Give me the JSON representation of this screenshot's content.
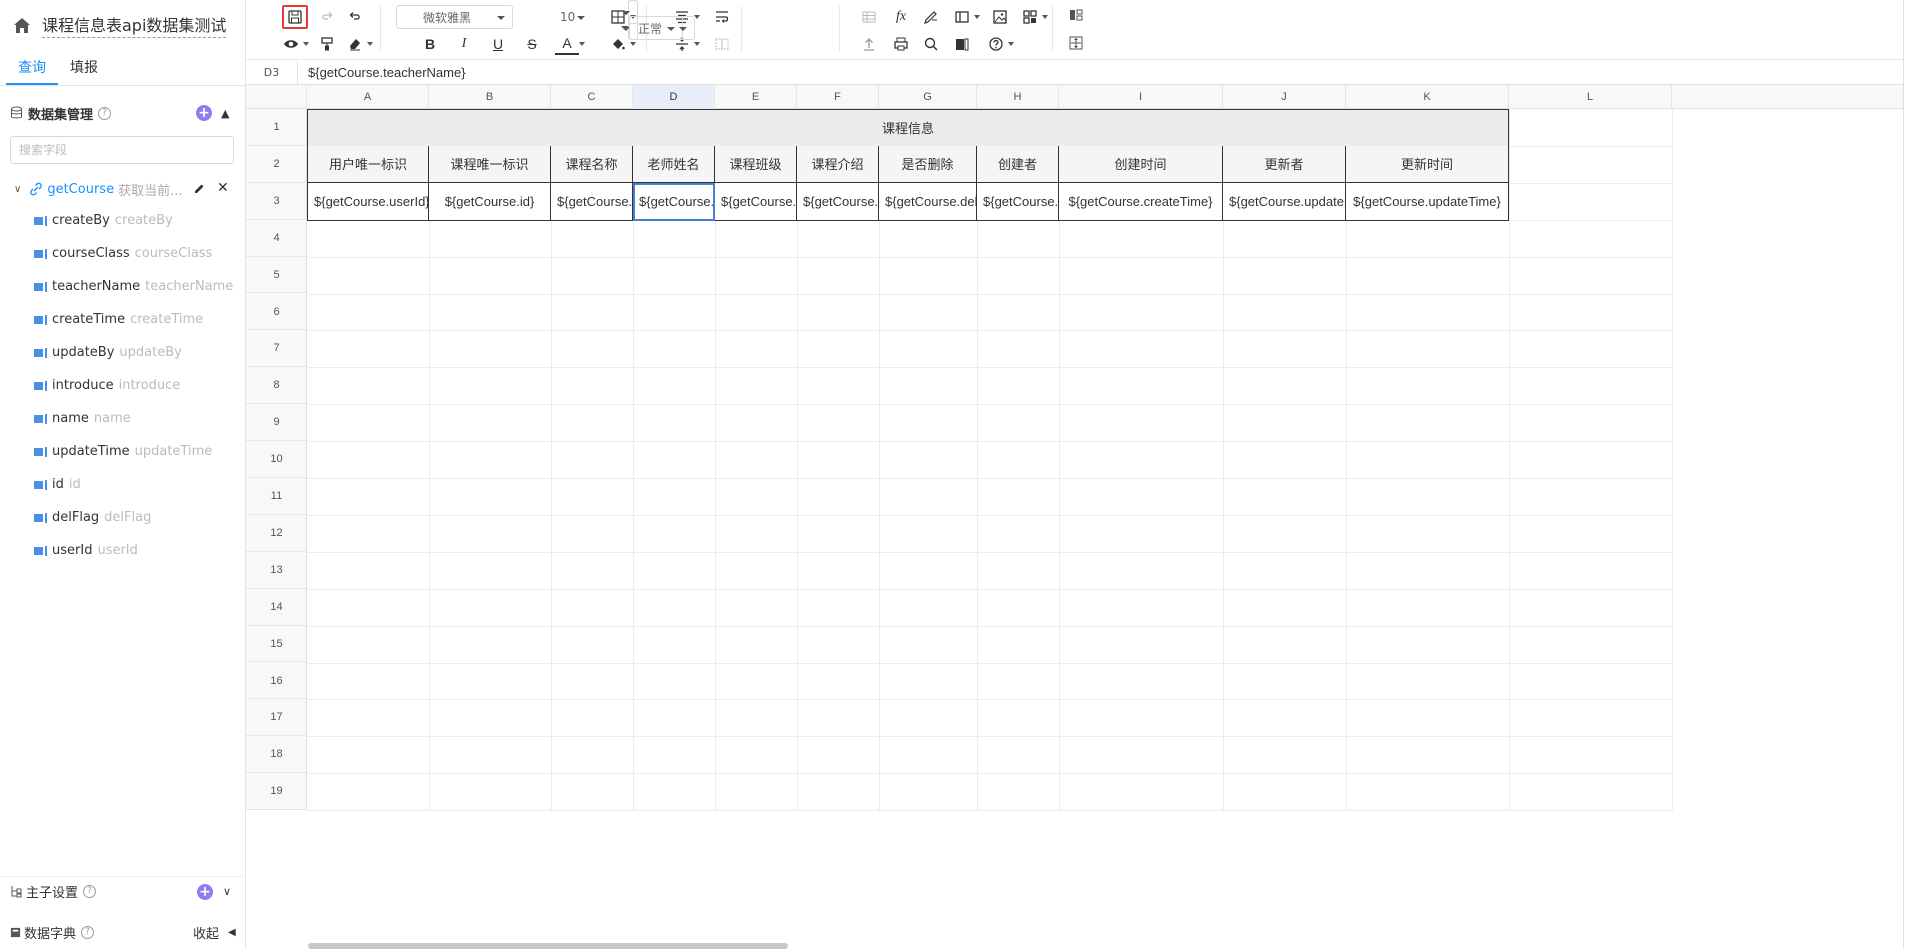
{
  "app": {
    "title": "课程信息表api数据集测试",
    "tabs": [
      "查询",
      "填报"
    ]
  },
  "dataset_panel": {
    "heading": "数据集管理",
    "help": "?",
    "search_placeholder": "搜索字段",
    "dataset": {
      "name": "getCourse",
      "desc": "获取当前..."
    },
    "fields": [
      {
        "name": "createBy",
        "desc": "createBy"
      },
      {
        "name": "courseClass",
        "desc": "courseClass"
      },
      {
        "name": "teacherName",
        "desc": "teacherName"
      },
      {
        "name": "createTime",
        "desc": "createTime"
      },
      {
        "name": "updateBy",
        "desc": "updateBy"
      },
      {
        "name": "introduce",
        "desc": "introduce"
      },
      {
        "name": "name",
        "desc": "name"
      },
      {
        "name": "updateTime",
        "desc": "updateTime"
      },
      {
        "name": "id",
        "desc": "id"
      },
      {
        "name": "delFlag",
        "desc": "delFlag"
      },
      {
        "name": "userId",
        "desc": "userId"
      }
    ]
  },
  "bottom": {
    "master_sub": "主子设置",
    "dictionary": "数据字典",
    "collapse": "收起"
  },
  "toolbar": {
    "font_family": "微软雅黑",
    "font_size": "10",
    "style": "正常"
  },
  "formula_bar": {
    "cell_ref": "D3",
    "value": "${getCourse.teacherName}"
  },
  "sheet": {
    "columns": [
      "A",
      "B",
      "C",
      "D",
      "E",
      "F",
      "G",
      "H",
      "I",
      "J",
      "K",
      "L"
    ],
    "selected_column": "D",
    "rows": [
      "1",
      "2",
      "3",
      "4",
      "5",
      "6",
      "7",
      "8",
      "9",
      "10",
      "11",
      "12",
      "13",
      "14",
      "15",
      "16",
      "17",
      "18",
      "19"
    ],
    "title": "课程信息",
    "headers": [
      "用户唯一标识",
      "课程唯一标识",
      "课程名称",
      "老师姓名",
      "课程班级",
      "课程介绍",
      "是否删除",
      "创建者",
      "创建时间",
      "更新者",
      "更新时间"
    ],
    "data": [
      "${getCourse.userId}",
      "${getCourse.id}",
      "${getCourse.n",
      "${getCourse.t",
      "${getCourse.c",
      "${getCourse.in",
      "${getCourse.delFl",
      "${getCourse.cr",
      "${getCourse.createTime}",
      "${getCourse.updateBy",
      "${getCourse.updateTime}"
    ],
    "active_cell": "D3"
  }
}
